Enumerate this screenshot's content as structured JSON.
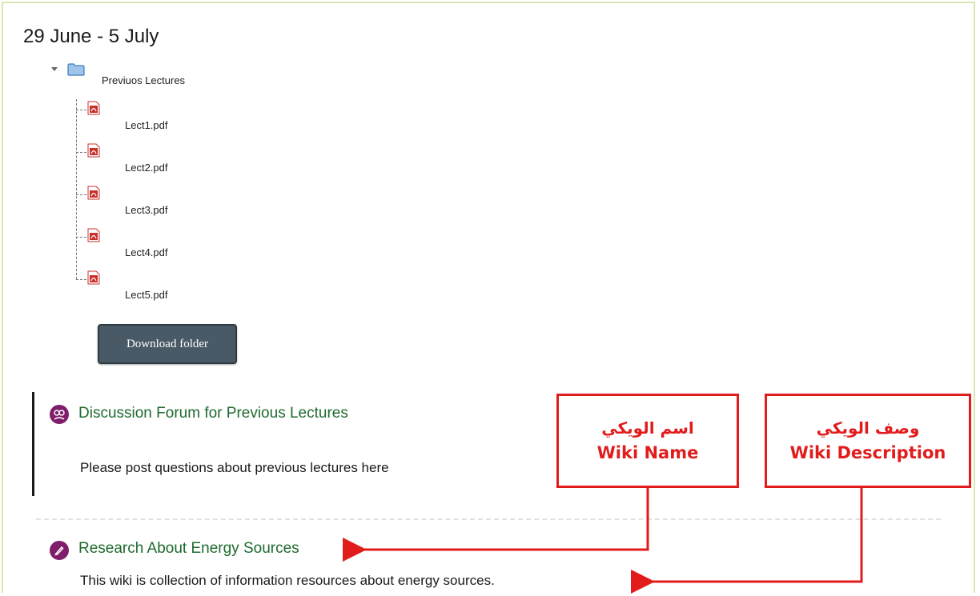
{
  "section": {
    "week_title": "29 June - 5 July"
  },
  "folder": {
    "name": "Previuos Lectures",
    "icon": "folder-icon",
    "files": [
      {
        "name": "Lect1.pdf",
        "icon": "pdf-file-icon"
      },
      {
        "name": "Lect2.pdf",
        "icon": "pdf-file-icon"
      },
      {
        "name": "Lect3.pdf",
        "icon": "pdf-file-icon"
      },
      {
        "name": "Lect4.pdf",
        "icon": "pdf-file-icon"
      },
      {
        "name": "Lect5.pdf",
        "icon": "pdf-file-icon"
      }
    ],
    "download_button_label": "Download folder"
  },
  "forum": {
    "title": "Discussion Forum for Previous Lectures",
    "description": "Please post questions about previous lectures here",
    "icon": "forum-icon"
  },
  "wiki": {
    "title": "Research About Energy Sources",
    "description": "This wiki is collection of information resources about energy sources.",
    "icon": "wiki-icon"
  },
  "annotations": {
    "wiki_name": {
      "arabic": "اسم الويكي",
      "english": "Wiki Name"
    },
    "wiki_description": {
      "arabic": "وصف الويكي",
      "english": "Wiki Description"
    }
  },
  "colors": {
    "link_green": "#1e6b2e",
    "annotation_red": "#e21b1b",
    "button_bg": "#495a66",
    "activity_icon_purple": "#7f1d6b"
  }
}
